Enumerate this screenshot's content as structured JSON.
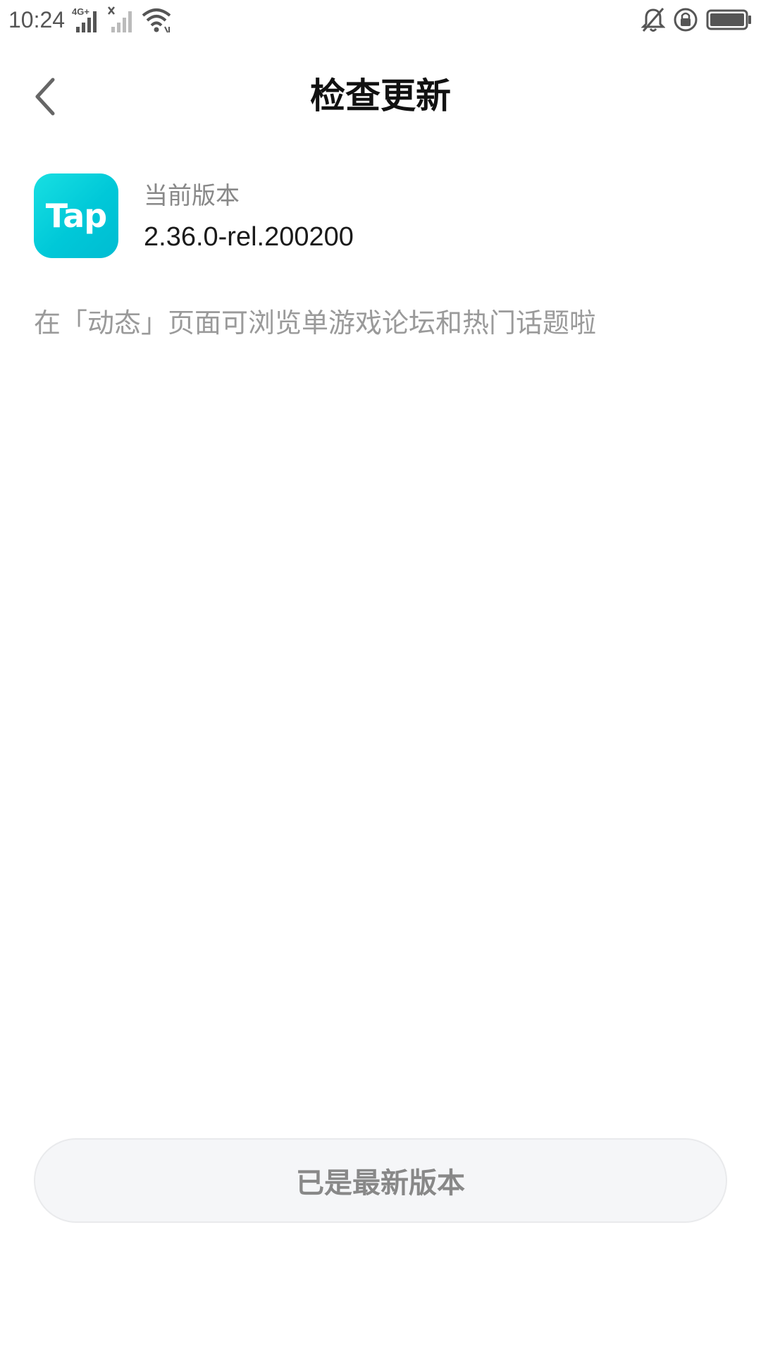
{
  "status_bar": {
    "time": "10:24",
    "network_label": "4G+",
    "icons": [
      "signal-4g-icon",
      "signal-no-sim-icon",
      "wifi-icon",
      "bell-off-icon",
      "rotation-lock-icon",
      "battery-icon"
    ]
  },
  "header": {
    "back_icon": "chevron-left-icon",
    "title": "检查更新"
  },
  "app_info": {
    "icon_text": "Tap",
    "version_label": "当前版本",
    "version_value": "2.36.0-rel.200200"
  },
  "update_note": "在「动态」页面可浏览单游戏论坛和热门话题啦",
  "action_button": {
    "label": "已是最新版本"
  },
  "colors": {
    "accent": "#00c8d8",
    "title_text": "#111111",
    "secondary_text": "#888888",
    "button_bg": "#f5f6f8"
  }
}
